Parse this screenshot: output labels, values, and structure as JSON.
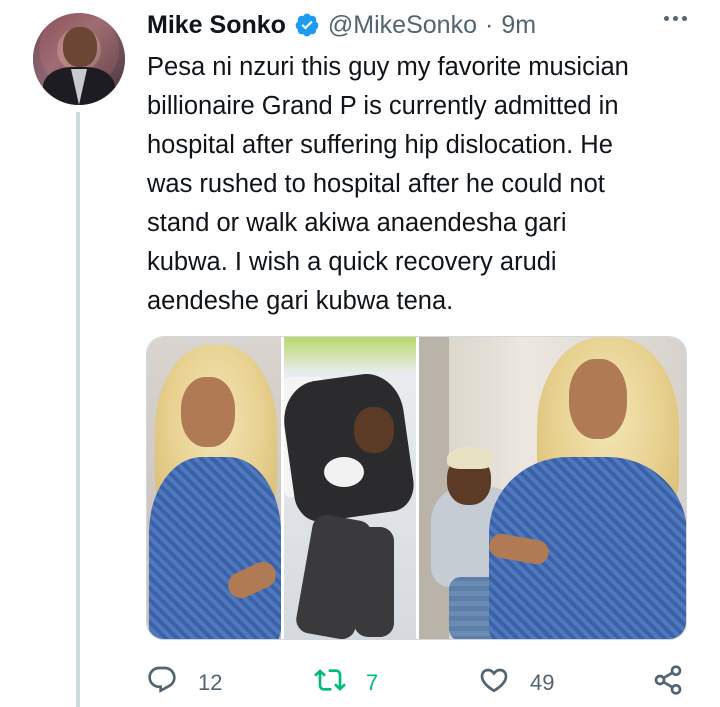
{
  "author": {
    "name": "Mike Sonko",
    "handle": "@MikeSonko",
    "separator": "·",
    "time": "9m"
  },
  "tweet": {
    "text": "Pesa ni nzuri this guy my favorite musician\nbillionaire Grand P is currently admitted in\nhospital after suffering hip dislocation. He\nwas rushed to hospital after he could not\nstand or walk akiwa anaendesha gari\nkubwa. I wish a quick recovery arudi\naendeshe gari kubwa tena."
  },
  "media": {
    "photos": [
      "woman-blonde-hair-photo",
      "man-in-hospital-bed-photo",
      "couple-photo"
    ]
  },
  "actions": {
    "reply_count": "12",
    "retweet_count": "7",
    "like_count": "49"
  },
  "icons": {
    "verified": "verified-badge-icon",
    "more": "more-options-icon",
    "reply": "reply-icon",
    "retweet": "retweet-icon",
    "like": "heart-icon",
    "share": "share-icon"
  },
  "colors": {
    "verified": "#1d9bf0",
    "retweet_active": "#00ba7c",
    "secondary_text": "#536471",
    "thread_line": "#cfd9de"
  }
}
